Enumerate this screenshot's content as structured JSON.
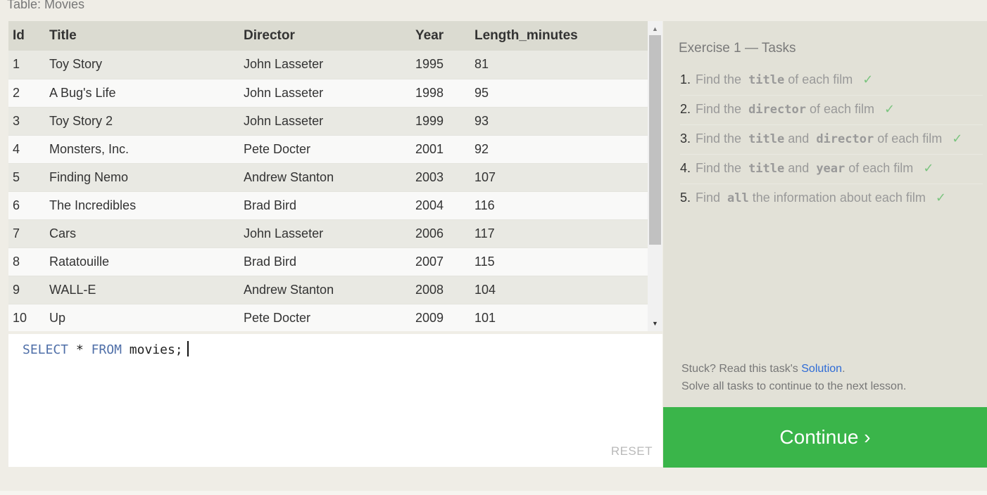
{
  "table_caption": "Table: Movies",
  "table": {
    "columns": [
      "Id",
      "Title",
      "Director",
      "Year",
      "Length_minutes"
    ],
    "rows": [
      [
        "1",
        "Toy Story",
        "John Lasseter",
        "1995",
        "81"
      ],
      [
        "2",
        "A Bug's Life",
        "John Lasseter",
        "1998",
        "95"
      ],
      [
        "3",
        "Toy Story 2",
        "John Lasseter",
        "1999",
        "93"
      ],
      [
        "4",
        "Monsters, Inc.",
        "Pete Docter",
        "2001",
        "92"
      ],
      [
        "5",
        "Finding Nemo",
        "Andrew Stanton",
        "2003",
        "107"
      ],
      [
        "6",
        "The Incredibles",
        "Brad Bird",
        "2004",
        "116"
      ],
      [
        "7",
        "Cars",
        "John Lasseter",
        "2006",
        "117"
      ],
      [
        "8",
        "Ratatouille",
        "Brad Bird",
        "2007",
        "115"
      ],
      [
        "9",
        "WALL-E",
        "Andrew Stanton",
        "2008",
        "104"
      ],
      [
        "10",
        "Up",
        "Pete Docter",
        "2009",
        "101"
      ]
    ]
  },
  "editor": {
    "kw_select": "SELECT",
    "star": "*",
    "kw_from": "FROM",
    "table_name": "movies;",
    "reset_label": "RESET"
  },
  "tasks": {
    "title": "Exercise 1 — Tasks",
    "check": "✓",
    "items": [
      {
        "num": "1.",
        "parts": [
          [
            "t",
            "Find the"
          ],
          [
            "c",
            "title"
          ],
          [
            "t",
            "of each film"
          ]
        ]
      },
      {
        "num": "2.",
        "parts": [
          [
            "t",
            "Find the"
          ],
          [
            "c",
            "director"
          ],
          [
            "t",
            "of each film"
          ]
        ]
      },
      {
        "num": "3.",
        "parts": [
          [
            "t",
            "Find the"
          ],
          [
            "c",
            "title"
          ],
          [
            "t",
            "and"
          ],
          [
            "c",
            "director"
          ],
          [
            "t",
            "of each film"
          ]
        ]
      },
      {
        "num": "4.",
        "parts": [
          [
            "t",
            "Find the"
          ],
          [
            "c",
            "title"
          ],
          [
            "t",
            "and"
          ],
          [
            "c",
            "year"
          ],
          [
            "t",
            "of each film"
          ]
        ]
      },
      {
        "num": "5.",
        "parts": [
          [
            "t",
            "Find"
          ],
          [
            "c",
            "all"
          ],
          [
            "t",
            "the information about each film"
          ]
        ]
      }
    ],
    "stuck_prefix": "Stuck? Read this task's",
    "solution_link": "Solution",
    "stuck_suffix": ".",
    "solve_all": "Solve all tasks to continue to the next lesson."
  },
  "continue_label": "Continue ›",
  "scroll": {
    "up_arrow": "▲",
    "down_arrow": "▼"
  },
  "colors": {
    "continue_bg": "#3ab54a",
    "link": "#2e6bd6",
    "check": "#7bc47f",
    "keyword": "#4f6fa8"
  }
}
